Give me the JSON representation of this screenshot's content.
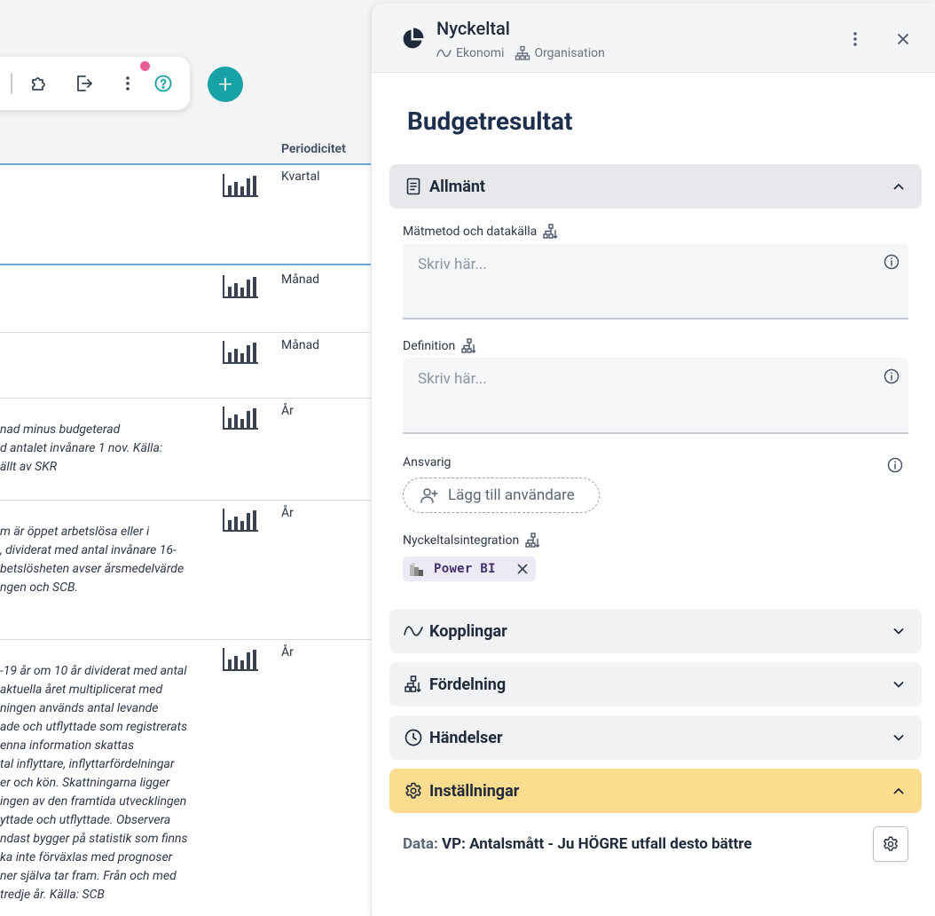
{
  "table": {
    "column_header": "Periodicitet",
    "rows": [
      {
        "period": "Kvartal",
        "desc": []
      },
      {
        "period": "Månad",
        "desc": []
      },
      {
        "period": "Månad",
        "desc": []
      },
      {
        "period": "År",
        "desc": [
          "nad minus budgeterad",
          "d antalet invånare 1 nov. Källa:",
          "ällt av SKR"
        ]
      },
      {
        "period": "År",
        "desc": [
          "m är öppet arbetslösa eller i",
          ", dividerat med antal invånare 16-",
          "betslösheten avser årsmedelvärde",
          "ngen och SCB."
        ]
      },
      {
        "period": "År",
        "desc": [
          "-19 år om 10 år dividerat med antal",
          "aktuella året multiplicerat med",
          "ningen används antal levande",
          "ade och utflyttade som registrerats",
          "enna information skattas",
          "tal inflyttare, inflyttarfördelningar",
          "er och kön. Skattningarna ligger",
          "ingen av den framtida utvecklingen",
          "yttade och utflyttade. Observera",
          "ndast bygger på statistik som finns",
          "ka inte förväxlas med prognoser",
          "ner själva tar fram. Från och med",
          "tredje år. Källa: SCB"
        ]
      }
    ]
  },
  "panel": {
    "title": "Nyckeltal",
    "crumb_1": "Ekonomi",
    "crumb_2": "Organisation",
    "kpi_title": "Budgetresultat",
    "sections": {
      "general": "Allmänt",
      "links": "Kopplingar",
      "distribution": "Fördelning",
      "events": "Händelser",
      "settings": "Inställningar"
    },
    "fields": {
      "method_label": "Mätmetod och datakälla",
      "method_placeholder": "Skriv här...",
      "definition_label": "Definition",
      "definition_placeholder": "Skriv här...",
      "responsible_label": "Ansvarig",
      "add_user_label": "Lägg till användare",
      "integration_label": "Nyckeltalsintegration",
      "integration_chip": "Power BI"
    },
    "settings_data": {
      "prefix": "Data:",
      "value": "VP: Antalsmått - Ju HÖGRE utfall desto bättre"
    }
  },
  "colors": {
    "accent": "#17a2a6",
    "notification": "#ea5c95",
    "settings_section": "#fcdc8f",
    "chip_bg": "#eceaf6",
    "chip_text": "#44306e",
    "title": "#1e2f4d"
  },
  "icons": {
    "toolbar": [
      "puzzle-icon",
      "export-icon",
      "kebab-icon",
      "help-icon"
    ],
    "panel_header": "pie-chart-icon",
    "crumbs": [
      "wave-icon",
      "org-chart-icon"
    ]
  }
}
